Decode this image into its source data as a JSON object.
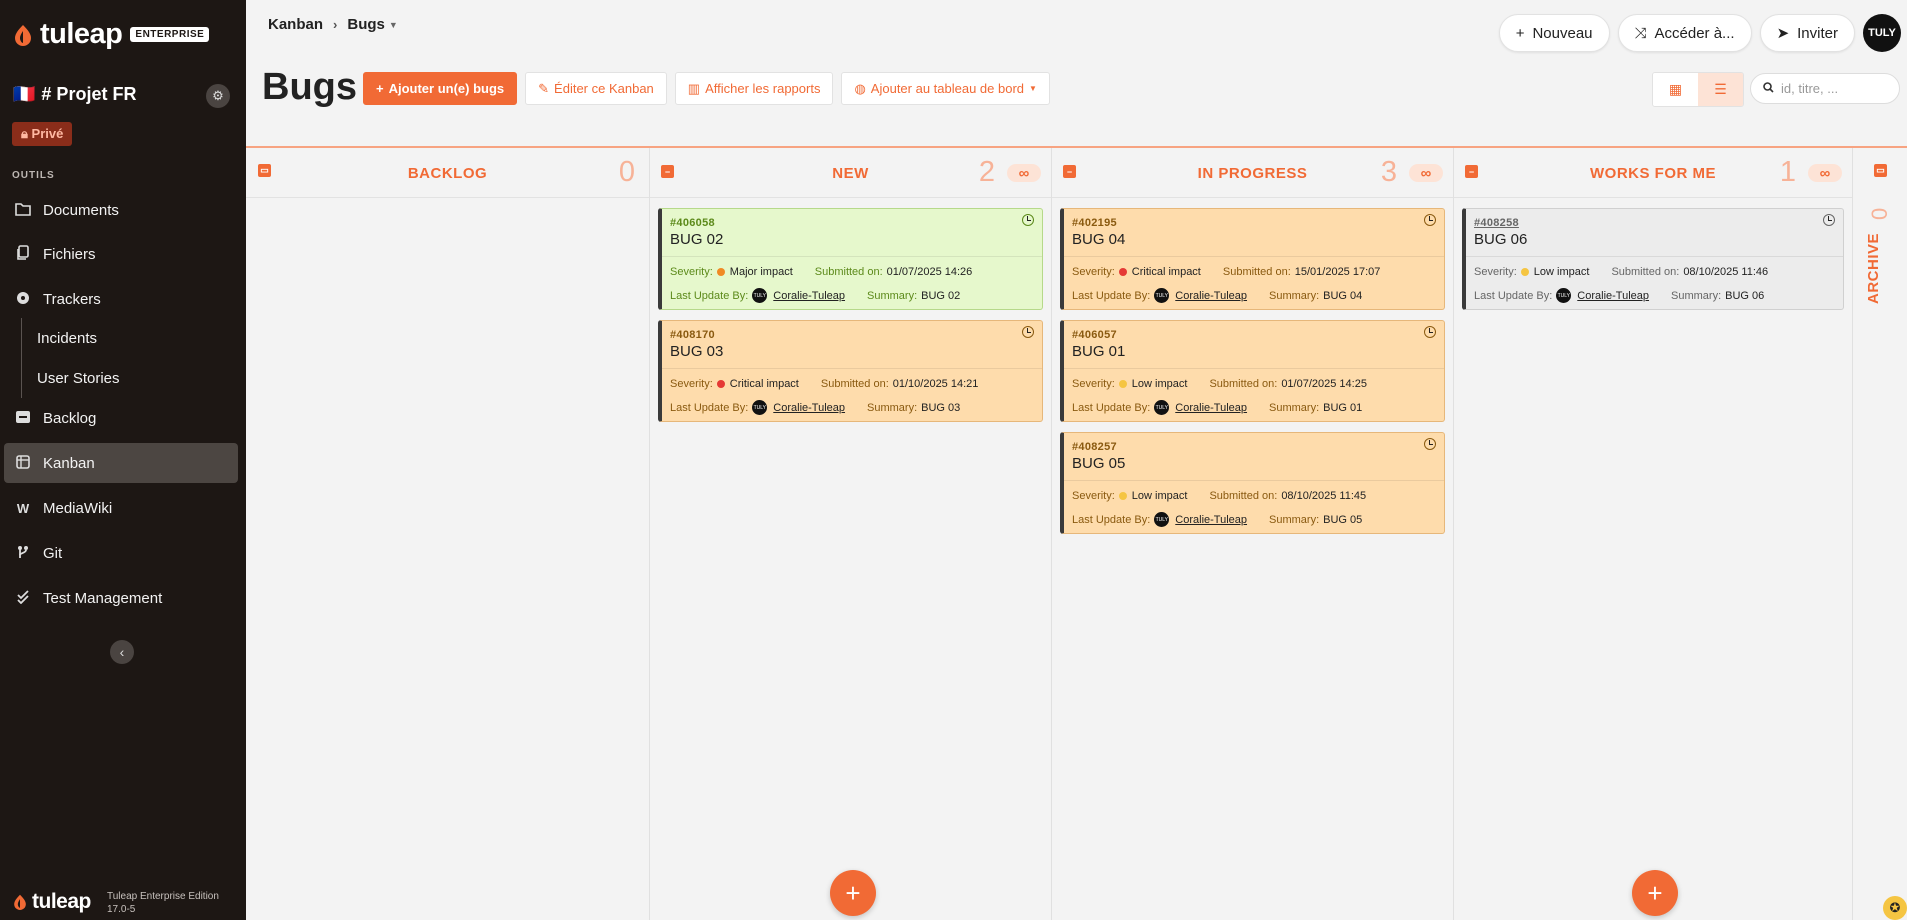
{
  "sidebar": {
    "logo_text": "tuleap",
    "edition_badge": "ENTERPRISE",
    "project_flag": "🇫🇷",
    "project_name": "# Projet FR",
    "privacy_badge": "Privé",
    "section_title": "OUTILS",
    "items": [
      {
        "label": "Documents",
        "icon": "folder-icon"
      },
      {
        "label": "Fichiers",
        "icon": "files-icon"
      },
      {
        "label": "Trackers",
        "icon": "trackers-icon"
      },
      {
        "label": "Backlog",
        "icon": "backlog-icon"
      },
      {
        "label": "Kanban",
        "icon": "kanban-icon"
      },
      {
        "label": "MediaWiki",
        "icon": "mediawiki-icon"
      },
      {
        "label": "Git",
        "icon": "git-icon"
      },
      {
        "label": "Test Management",
        "icon": "test-management-icon"
      }
    ],
    "subitems": [
      "Incidents",
      "User Stories"
    ],
    "footer_logo": "tuleap",
    "footer_edition_line1": "Tuleap Enterprise Edition",
    "footer_edition_line2": "17.0-5"
  },
  "header": {
    "breadcrumb": [
      "Kanban",
      "Bugs"
    ],
    "buttons": {
      "new": "Nouveau",
      "goto": "Accéder à...",
      "invite": "Inviter"
    },
    "avatar": "TULY"
  },
  "page": {
    "title": "Bugs",
    "toolbar": {
      "add": "Ajouter un(e) bugs",
      "edit": "Éditer ce Kanban",
      "reports": "Afficher les rapports",
      "dashboard": "Ajouter au tableau de bord"
    },
    "search_placeholder": "id, titre, ..."
  },
  "labels": {
    "severity": "Severity:",
    "submitted": "Submitted on:",
    "last_update": "Last Update By:",
    "summary": "Summary:",
    "wip": "∞",
    "avatar_mini": "TULY",
    "add": "+"
  },
  "columns": [
    {
      "name": "BACKLOG",
      "count": "0",
      "cards": []
    },
    {
      "name": "NEW",
      "count": "2",
      "cards": [
        {
          "id": "#406058",
          "title": "BUG 02",
          "severity": "Major impact",
          "submitted": "01/07/2025 14:26",
          "user": "Coralie-Tuleap",
          "summary": "BUG 02"
        },
        {
          "id": "#408170",
          "title": "BUG 03",
          "severity": "Critical impact",
          "submitted": "01/10/2025 14:21",
          "user": "Coralie-Tuleap",
          "summary": "BUG 03"
        }
      ]
    },
    {
      "name": "IN PROGRESS",
      "count": "3",
      "cards": [
        {
          "id": "#402195",
          "title": "BUG 04",
          "severity": "Critical impact",
          "submitted": "15/01/2025 17:07",
          "user": "Coralie-Tuleap",
          "summary": "BUG 04"
        },
        {
          "id": "#406057",
          "title": "BUG 01",
          "severity": "Low impact",
          "submitted": "01/07/2025 14:25",
          "user": "Coralie-Tuleap",
          "summary": "BUG 01"
        },
        {
          "id": "#408257",
          "title": "BUG 05",
          "severity": "Low impact",
          "submitted": "08/10/2025 11:45",
          "user": "Coralie-Tuleap",
          "summary": "BUG 05"
        }
      ]
    },
    {
      "name": "WORKS FOR ME",
      "count": "1",
      "cards": [
        {
          "id": "#408258",
          "title": "BUG 06",
          "severity": "Low impact",
          "submitted": "08/10/2025 11:46",
          "user": "Coralie-Tuleap",
          "summary": "BUG 06"
        }
      ]
    },
    {
      "name": "ARCHIVE",
      "count": "0",
      "cards": []
    }
  ],
  "colors": {
    "accent": "#f16a35",
    "critical": "#e53935",
    "major": "#f08a24",
    "low": "#f5c542"
  }
}
